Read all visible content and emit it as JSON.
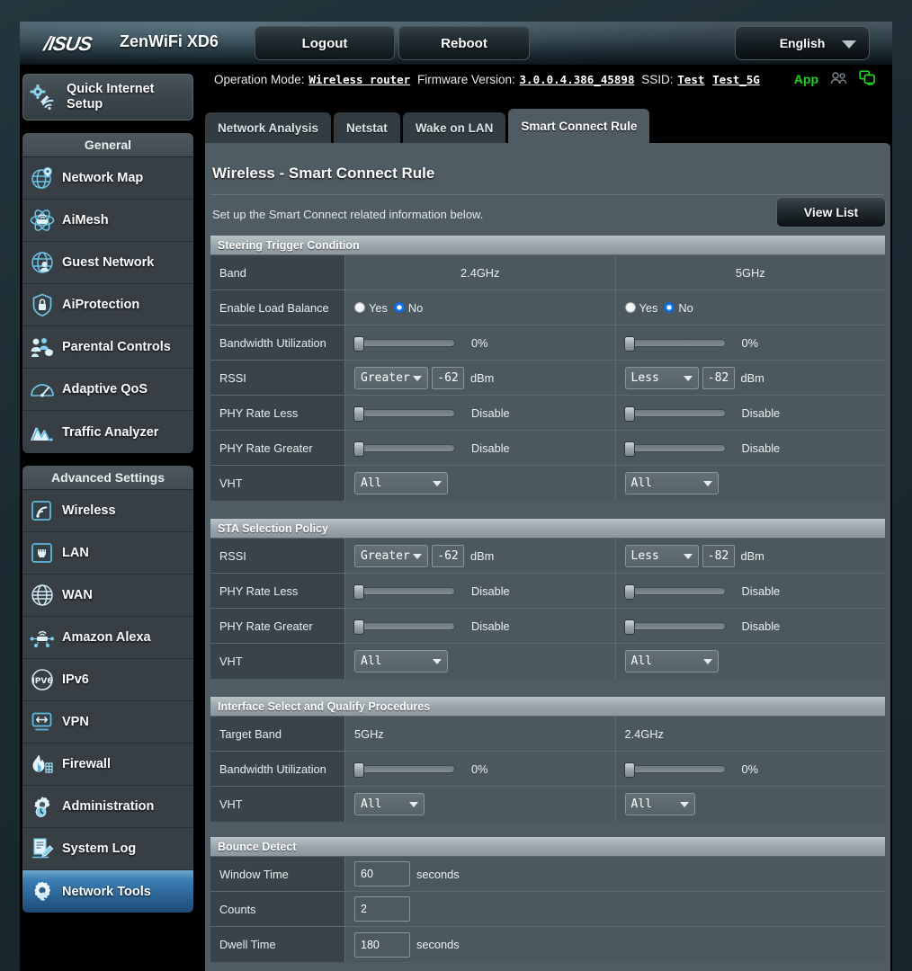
{
  "header": {
    "brand": "/ISUS",
    "model": "ZenWiFi XD6",
    "logout_label": "Logout",
    "reboot_label": "Reboot",
    "language": "English"
  },
  "status": {
    "operation_mode_label": "Operation Mode:",
    "operation_mode_value": "Wireless router",
    "firmware_label": "Firmware Version:",
    "firmware_value": "3.0.0.4.386_45898",
    "ssid_label": "SSID:",
    "ssid_value_1": "Test",
    "ssid_value_2": "Test_5G",
    "app_label": "App"
  },
  "sidebar": {
    "quick_internet_setup": "Quick Internet Setup",
    "general_title": "General",
    "general_items": [
      {
        "label": "Network Map",
        "icon": "network-map-icon"
      },
      {
        "label": "AiMesh",
        "icon": "aimesh-icon"
      },
      {
        "label": "Guest Network",
        "icon": "guest-network-icon"
      },
      {
        "label": "AiProtection",
        "icon": "shield-icon"
      },
      {
        "label": "Parental Controls",
        "icon": "parental-controls-icon"
      },
      {
        "label": "Adaptive QoS",
        "icon": "gauge-icon"
      },
      {
        "label": "Traffic Analyzer",
        "icon": "traffic-analyzer-icon"
      }
    ],
    "advanced_title": "Advanced Settings",
    "advanced_items": [
      {
        "label": "Wireless",
        "icon": "wireless-icon"
      },
      {
        "label": "LAN",
        "icon": "lan-icon"
      },
      {
        "label": "WAN",
        "icon": "globe-icon"
      },
      {
        "label": "Amazon Alexa",
        "icon": "alexa-icon"
      },
      {
        "label": "IPv6",
        "icon": "ipv6-icon"
      },
      {
        "label": "VPN",
        "icon": "vpn-icon"
      },
      {
        "label": "Firewall",
        "icon": "firewall-icon"
      },
      {
        "label": "Administration",
        "icon": "administration-icon"
      },
      {
        "label": "System Log",
        "icon": "system-log-icon"
      },
      {
        "label": "Network Tools",
        "icon": "network-tools-icon"
      }
    ],
    "active_item": "Network Tools"
  },
  "tabs": [
    {
      "label": "Network Analysis",
      "active": false
    },
    {
      "label": "Netstat",
      "active": false
    },
    {
      "label": "Wake on LAN",
      "active": false
    },
    {
      "label": "Smart Connect Rule",
      "active": true
    }
  ],
  "main": {
    "title": "Wireless - Smart Connect Rule",
    "description": "Set up the Smart Connect related information below.",
    "view_list_label": "View List"
  },
  "steering": {
    "section_title": "Steering Trigger Condition",
    "band_label": "Band",
    "band_24": "2.4GHz",
    "band_5": "5GHz",
    "load_balance_label": "Enable Load Balance",
    "yes_label": "Yes",
    "no_label": "No",
    "lb_24_selected": "No",
    "lb_5_selected": "No",
    "bw_label": "Bandwidth Utilization",
    "bw_24": "0%",
    "bw_5": "0%",
    "rssi_label": "RSSI",
    "rssi_24_op": "Greater",
    "rssi_24_val": "-62",
    "rssi_5_op": "Less",
    "rssi_5_val": "-82",
    "dbm": "dBm",
    "phy_less_label": "PHY Rate Less",
    "phy_less_24": "Disable",
    "phy_less_5": "Disable",
    "phy_greater_label": "PHY Rate Greater",
    "phy_greater_24": "Disable",
    "phy_greater_5": "Disable",
    "vht_label": "VHT",
    "vht_24": "All",
    "vht_5": "All"
  },
  "sta": {
    "section_title": "STA Selection Policy",
    "rssi_label": "RSSI",
    "rssi_24_op": "Greater",
    "rssi_24_val": "-62",
    "rssi_5_op": "Less",
    "rssi_5_val": "-82",
    "dbm": "dBm",
    "phy_less_label": "PHY Rate Less",
    "phy_less_24": "Disable",
    "phy_less_5": "Disable",
    "phy_greater_label": "PHY Rate Greater",
    "phy_greater_24": "Disable",
    "phy_greater_5": "Disable",
    "vht_label": "VHT",
    "vht_24": "All",
    "vht_5": "All"
  },
  "interface": {
    "section_title": "Interface Select and Qualify Procedures",
    "target_band_label": "Target Band",
    "target_band_1": "5GHz",
    "target_band_2": "2.4GHz",
    "bw_label": "Bandwidth Utilization",
    "bw_1": "0%",
    "bw_2": "0%",
    "vht_label": "VHT",
    "vht_1": "All",
    "vht_2": "All"
  },
  "bounce": {
    "section_title": "Bounce Detect",
    "window_time_label": "Window Time",
    "window_time_value": "60",
    "window_time_unit": "seconds",
    "counts_label": "Counts",
    "counts_value": "2",
    "dwell_time_label": "Dwell Time",
    "dwell_time_value": "180",
    "dwell_time_unit": "seconds"
  },
  "colors": {
    "accent_blue": "#2b6494",
    "app_green": "#1fd11f",
    "panel": "#4f5c63",
    "label_cell": "#39434a",
    "section_head": "#98a4aa"
  }
}
